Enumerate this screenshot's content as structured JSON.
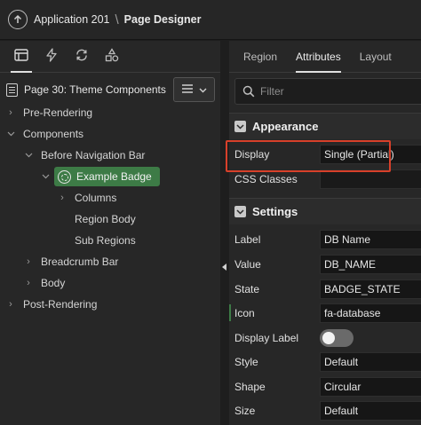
{
  "header": {
    "app_name": "Application 201",
    "separator": "\\",
    "page_title": "Page Designer",
    "app_icon": "arrow-up-circle-icon"
  },
  "left_tabs": [
    {
      "icon": "rendering-tree-icon",
      "active": true
    },
    {
      "icon": "lightning-icon",
      "active": false
    },
    {
      "icon": "refresh-cycle-icon",
      "active": false
    },
    {
      "icon": "shared-components-icon",
      "active": false
    }
  ],
  "page_node": {
    "label": "Page 30: Theme Components",
    "icon": "page-icon",
    "menu_icon": "hamburger-icon"
  },
  "tree": [
    {
      "label": "Pre-Rendering",
      "level": 0,
      "chevron": "right"
    },
    {
      "label": "Components",
      "level": 0,
      "chevron": "down"
    },
    {
      "label": "Before Navigation Bar",
      "level": 1,
      "chevron": "down"
    },
    {
      "label": "Example Badge",
      "level": 2,
      "chevron": "down",
      "selected": true
    },
    {
      "label": "Columns",
      "level": 3,
      "chevron": "right"
    },
    {
      "label": "Region Body",
      "level": 3,
      "chevron": "none"
    },
    {
      "label": "Sub Regions",
      "level": 3,
      "chevron": "none"
    },
    {
      "label": "Breadcrumb Bar",
      "level": 1,
      "chevron": "right"
    },
    {
      "label": "Body",
      "level": 1,
      "chevron": "right"
    },
    {
      "label": "Post-Rendering",
      "level": 0,
      "chevron": "right"
    }
  ],
  "right_tabs": [
    {
      "label": "Region",
      "active": false
    },
    {
      "label": "Attributes",
      "active": true
    },
    {
      "label": "Layout",
      "active": false
    }
  ],
  "filter": {
    "placeholder": "Filter",
    "value": ""
  },
  "groups": {
    "appearance": {
      "title": "Appearance",
      "props": [
        {
          "label": "Display",
          "value": "Single (Partial)"
        },
        {
          "label": "CSS Classes",
          "value": ""
        }
      ]
    },
    "settings": {
      "title": "Settings",
      "props": [
        {
          "label": "Label",
          "value": "DB Name"
        },
        {
          "label": "Value",
          "value": "DB_NAME"
        },
        {
          "label": "State",
          "value": "BADGE_STATE"
        },
        {
          "label": "Icon",
          "value": "fa-database"
        },
        {
          "label": "Display Label",
          "value": "",
          "toggle": "off"
        },
        {
          "label": "Style",
          "value": "Default"
        },
        {
          "label": "Shape",
          "value": "Circular"
        },
        {
          "label": "Size",
          "value": "Default"
        }
      ]
    }
  },
  "colors": {
    "selected_node": "#3d7b46",
    "highlight_box": "#d8402a",
    "background": "#272727"
  }
}
